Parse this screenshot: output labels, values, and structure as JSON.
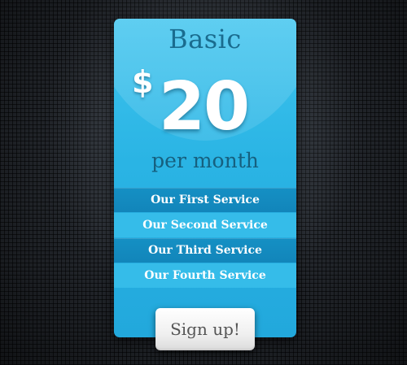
{
  "pricing_card": {
    "plan_name": "Basic",
    "currency_symbol": "$",
    "price": "20",
    "period": "per month",
    "features": [
      {
        "label": "Our First Service",
        "style": "dark"
      },
      {
        "label": "Our Second Service",
        "style": "light"
      },
      {
        "label": "Our Third Service",
        "style": "dark"
      },
      {
        "label": "Our Fourth Service",
        "style": "light"
      }
    ],
    "cta_label": "Sign up!"
  },
  "colors": {
    "card_blue": "#2ab4e4",
    "row_dark_blue": "#1285ba",
    "title_text": "#1a6c8f",
    "button_white": "#f0f0f0"
  }
}
